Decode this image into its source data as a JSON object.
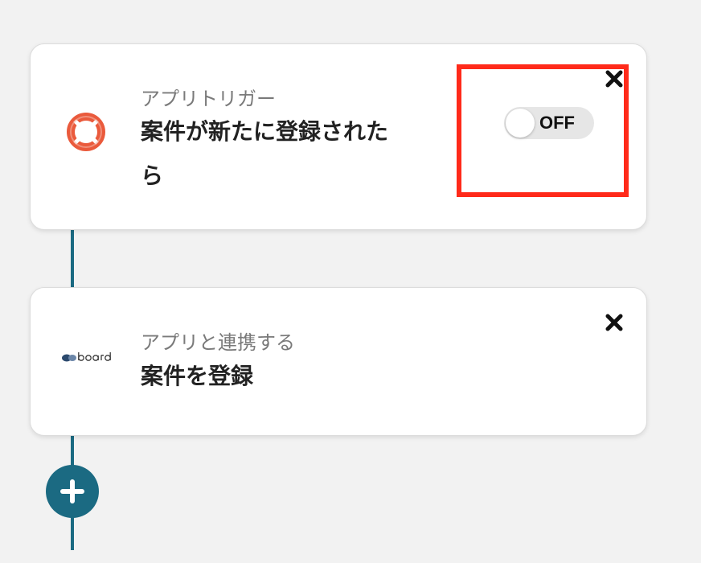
{
  "trigger_card": {
    "subtitle": "アプリトリガー",
    "title": "案件が新たに登録されたら",
    "icon": "lifebuoy-icon",
    "toggle": {
      "label": "OFF",
      "state": false
    }
  },
  "action_card": {
    "subtitle": "アプリと連携する",
    "title": "案件を登録",
    "icon": "board-logo"
  },
  "add_step": {
    "icon": "plus-icon"
  },
  "colors": {
    "accent": "#1b6a82",
    "highlight": "#ff2a1a",
    "lifebuoy": "#ea5a3c"
  }
}
